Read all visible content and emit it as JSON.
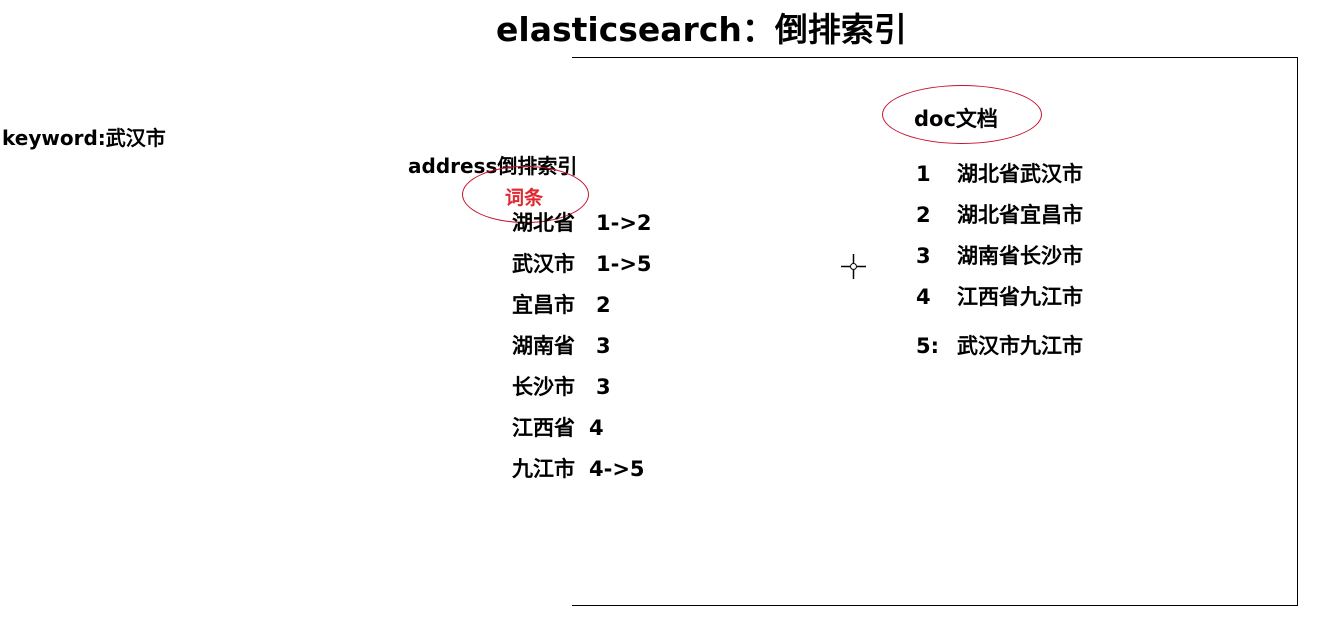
{
  "title": "elasticsearch：倒排索引",
  "keyword": "keyword:武汉市",
  "inverted_index": {
    "title": "address倒排索引",
    "term_label": "词条",
    "terms": [
      {
        "term": "湖北省",
        "doc_ids": "1->2"
      },
      {
        "term": "武汉市",
        "doc_ids": "1->5"
      },
      {
        "term": "宜昌市",
        "doc_ids": "2"
      },
      {
        "term": "湖南省",
        "doc_ids": "3"
      },
      {
        "term": "长沙市",
        "doc_ids": "3"
      },
      {
        "term": "江西省",
        "doc_ids": "4"
      },
      {
        "term": "九江市",
        "doc_ids": "4->5"
      }
    ]
  },
  "documents": {
    "title": "doc文档",
    "docs": [
      {
        "id": "1",
        "text": "湖北省武汉市"
      },
      {
        "id": "2",
        "text": "湖北省宜昌市"
      },
      {
        "id": "3",
        "text": "湖南省长沙市"
      },
      {
        "id": "4",
        "text": "江西省九江市"
      },
      {
        "id": "5:",
        "text": "武汉市九江市"
      }
    ]
  },
  "colors": {
    "term_label": "#e0282f",
    "highlight_oval": "#c8102e"
  },
  "cursor_icon": "crosshair-cursor-icon"
}
